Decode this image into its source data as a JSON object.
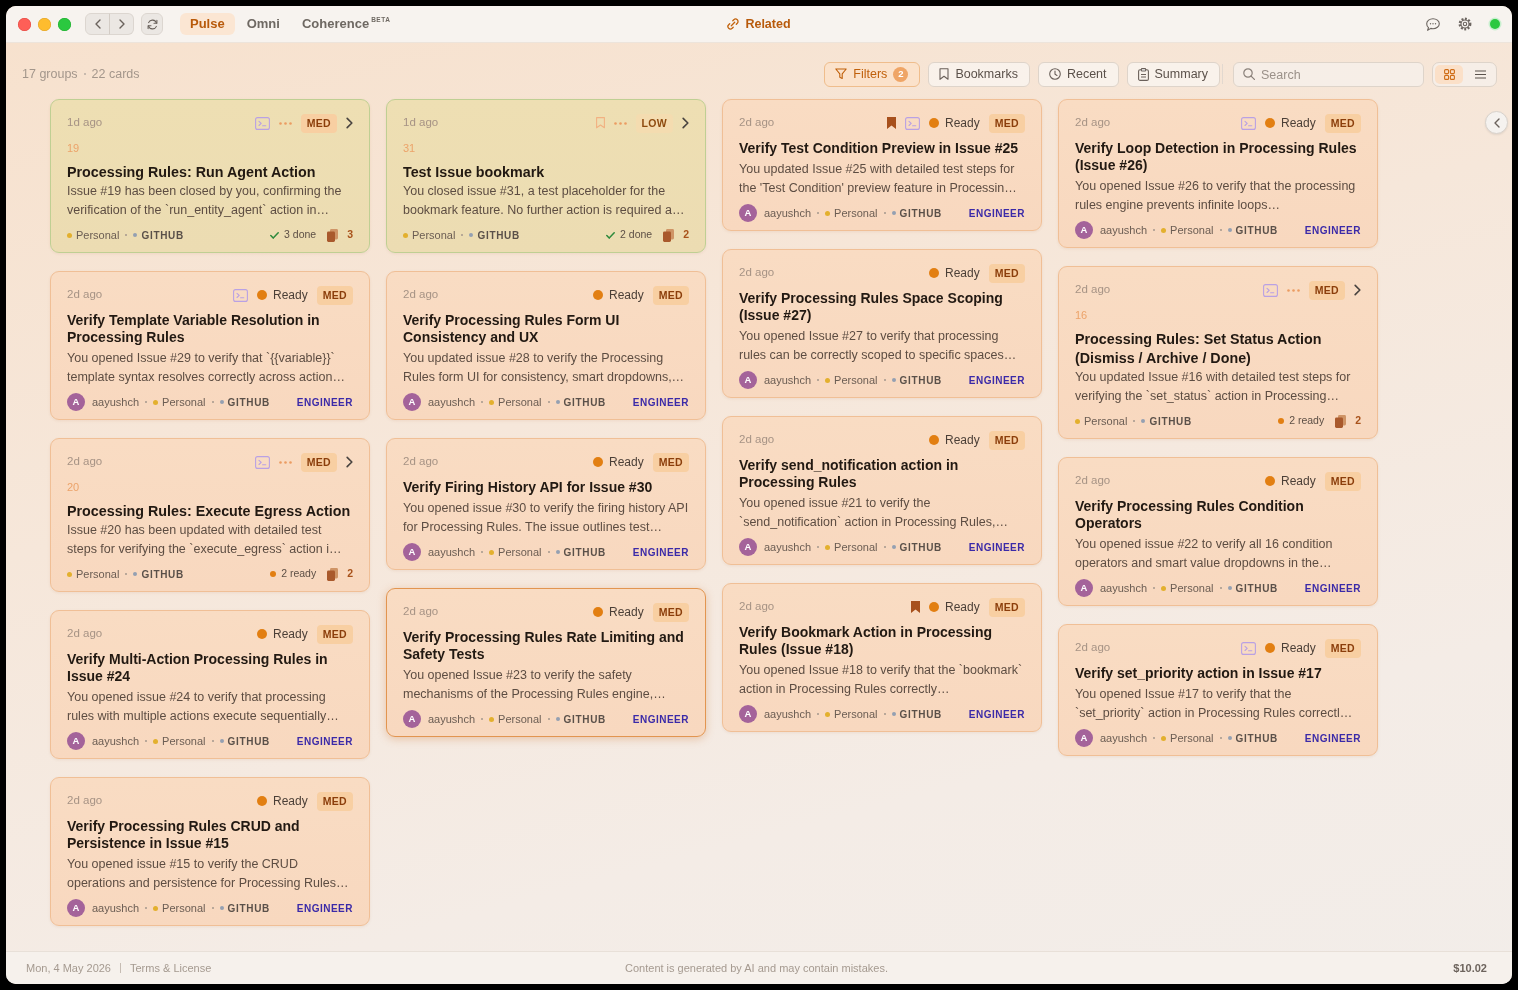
{
  "window": {
    "tabs": [
      {
        "label": "Pulse",
        "selected": true
      },
      {
        "label": "Omni",
        "selected": false
      },
      {
        "label": "Coherence$^{BETA}$",
        "selected": false
      }
    ],
    "header_link": "Related",
    "online": true
  },
  "toolbar": {
    "groups": "17 groups",
    "cards": "22 cards",
    "buttons": [
      {
        "label": "Filters",
        "badge": "2",
        "selected": true
      },
      {
        "label": "Bookmarks",
        "selected": false
      },
      {
        "label": "Recent",
        "selected": false
      },
      {
        "label": "Summary",
        "selected": false
      }
    ],
    "search": {
      "placeholder": "Search"
    },
    "views": [
      {
        "kind": "grid",
        "selected": true
      },
      {
        "kind": "list",
        "selected": false
      }
    ]
  },
  "board": {
    "columns": [
      {
        "cards": [
          {
            "kind": "group",
            "time": "1d ago",
            "terminal": true,
            "priority": {
              "label": "MED",
              "kind": "med"
            },
            "number": "19",
            "title": "Processing Rules: Run Agent Action",
            "description": "Issue #19 has been closed by you, confirming the verification of the `run_entity_agent` action in…",
            "space": "Personal",
            "source": "GITHUB",
            "progress": {
              "kind": "done",
              "text": "3 done"
            },
            "count": "3",
            "selected": false
          },
          {
            "kind": "issue",
            "time": "2d ago",
            "terminal": true,
            "status": "Ready",
            "priority": {
              "label": "MED",
              "kind": "med"
            },
            "title": "Verify Template Variable Resolution in Processing Rules",
            "description": "You opened Issue #29 to verify that `{{variable}}` template syntax resolves correctly across action…",
            "author": {
              "initial": "A",
              "name": "aayushch"
            },
            "space": "Personal",
            "source": "GITHUB",
            "role": "ENGINEER",
            "selected": false
          },
          {
            "kind": "group",
            "time": "2d ago",
            "terminal": true,
            "priority": {
              "label": "MED",
              "kind": "med"
            },
            "number": "20",
            "title": "Processing Rules: Execute Egress Action",
            "description": "Issue #20 has been updated with detailed test steps for verifying the `execute_egress` action i…",
            "space": "Personal",
            "source": "GITHUB",
            "progress": {
              "kind": "ready",
              "text": "2 ready"
            },
            "count": "2",
            "selected": false
          },
          {
            "kind": "issue",
            "time": "2d ago",
            "terminal": false,
            "status": "Ready",
            "priority": {
              "label": "MED",
              "kind": "med"
            },
            "title": "Verify Multi-Action Processing Rules in Issue #24",
            "description": "You opened issue #24 to verify that processing rules with multiple actions execute sequentially…",
            "author": {
              "initial": "A",
              "name": "aayushch"
            },
            "space": "Personal",
            "source": "GITHUB",
            "role": "ENGINEER",
            "selected": false
          },
          {
            "kind": "issue",
            "time": "2d ago",
            "terminal": false,
            "status": "Ready",
            "priority": {
              "label": "MED",
              "kind": "med"
            },
            "title": "Verify Processing Rules CRUD and Persistence in Issue #15",
            "description": "You opened issue #15 to verify the CRUD operations and persistence for Processing Rules…",
            "author": {
              "initial": "A",
              "name": "aayushch"
            },
            "space": "Personal",
            "source": "GITHUB",
            "role": "ENGINEER",
            "selected": false
          }
        ]
      },
      {
        "cards": [
          {
            "kind": "group",
            "time": "1d ago",
            "bookmarked": false,
            "terminal": false,
            "priority": {
              "label": "LOW",
              "kind": "low"
            },
            "number": "31",
            "title": "Test Issue bookmark",
            "description": "You closed issue #31, a test placeholder for the bookmark feature. No further action is required a…",
            "space": "Personal",
            "source": "GITHUB",
            "progress": {
              "kind": "done",
              "text": "2 done"
            },
            "count": "2",
            "selected": false
          },
          {
            "kind": "issue",
            "time": "2d ago",
            "terminal": false,
            "status": "Ready",
            "priority": {
              "label": "MED",
              "kind": "med"
            },
            "title": "Verify Processing Rules Form UI Consistency and UX",
            "description": "You updated issue #28 to verify the Processing Rules form UI for consistency, smart dropdowns,…",
            "author": {
              "initial": "A",
              "name": "aayushch"
            },
            "space": "Personal",
            "source": "GITHUB",
            "role": "ENGINEER",
            "selected": false
          },
          {
            "kind": "issue",
            "time": "2d ago",
            "terminal": false,
            "status": "Ready",
            "priority": {
              "label": "MED",
              "kind": "med"
            },
            "title": "Verify Firing History API for Issue #30",
            "description": "You opened issue #30 to verify the firing history API for Processing Rules. The issue outlines test…",
            "author": {
              "initial": "A",
              "name": "aayushch"
            },
            "space": "Personal",
            "source": "GITHUB",
            "role": "ENGINEER",
            "selected": false
          },
          {
            "kind": "issue",
            "time": "2d ago",
            "terminal": false,
            "status": "Ready",
            "priority": {
              "label": "MED",
              "kind": "med"
            },
            "title": "Verify Processing Rules Rate Limiting and Safety Tests",
            "description": "You opened Issue #23 to verify the safety mechanisms of the Processing Rules engine,…",
            "author": {
              "initial": "A",
              "name": "aayushch"
            },
            "space": "Personal",
            "source": "GITHUB",
            "role": "ENGINEER",
            "selected": true
          }
        ]
      },
      {
        "cards": [
          {
            "kind": "issue",
            "time": "2d ago",
            "bookmarked": true,
            "terminal": true,
            "status": "Ready",
            "priority": {
              "label": "MED",
              "kind": "med"
            },
            "title": "Verify Test Condition Preview in Issue #25",
            "description": "You updated Issue #25 with detailed test steps for the 'Test Condition' preview feature in Processin…",
            "author": {
              "initial": "A",
              "name": "aayushch"
            },
            "space": "Personal",
            "source": "GITHUB",
            "role": "ENGINEER",
            "selected": false
          },
          {
            "kind": "issue",
            "time": "2d ago",
            "terminal": false,
            "status": "Ready",
            "priority": {
              "label": "MED",
              "kind": "med"
            },
            "title": "Verify Processing Rules Space Scoping (Issue #27)",
            "description": "You opened Issue #27 to verify that processing rules can be correctly scoped to specific spaces…",
            "author": {
              "initial": "A",
              "name": "aayushch"
            },
            "space": "Personal",
            "source": "GITHUB",
            "role": "ENGINEER",
            "selected": false
          },
          {
            "kind": "issue",
            "time": "2d ago",
            "terminal": false,
            "status": "Ready",
            "priority": {
              "label": "MED",
              "kind": "med"
            },
            "title": "Verify send_notification action in Processing Rules",
            "description": "You opened issue #21 to verify the `send_notification` action in Processing Rules,…",
            "author": {
              "initial": "A",
              "name": "aayushch"
            },
            "space": "Personal",
            "source": "GITHUB",
            "role": "ENGINEER",
            "selected": false
          },
          {
            "kind": "issue",
            "time": "2d ago",
            "bookmarked": true,
            "terminal": false,
            "status": "Ready",
            "priority": {
              "label": "MED",
              "kind": "med"
            },
            "title": "Verify Bookmark Action in Processing Rules (Issue #18)",
            "description": "You opened Issue #18 to verify that the `bookmark` action in Processing Rules correctly…",
            "author": {
              "initial": "A",
              "name": "aayushch"
            },
            "space": "Personal",
            "source": "GITHUB",
            "role": "ENGINEER",
            "selected": false
          }
        ]
      },
      {
        "cards": [
          {
            "kind": "issue",
            "time": "2d ago",
            "terminal": true,
            "status": "Ready",
            "priority": {
              "label": "MED",
              "kind": "med"
            },
            "title": "Verify Loop Detection in Processing Rules (Issue #26)",
            "description": "You opened Issue #26 to verify that the processing rules engine prevents infinite loops…",
            "author": {
              "initial": "A",
              "name": "aayushch"
            },
            "space": "Personal",
            "source": "GITHUB",
            "role": "ENGINEER",
            "selected": false
          },
          {
            "kind": "group",
            "time": "2d ago",
            "terminal": true,
            "priority": {
              "label": "MED",
              "kind": "med"
            },
            "number": "16",
            "title": "Processing Rules: Set Status Action (Dismiss / Archive / Done)",
            "description": "You updated Issue #16 with detailed test steps for verifying the `set_status` action in Processing…",
            "space": "Personal",
            "source": "GITHUB",
            "progress": {
              "kind": "ready",
              "text": "2 ready"
            },
            "count": "2",
            "selected": false
          },
          {
            "kind": "issue",
            "time": "2d ago",
            "terminal": false,
            "status": "Ready",
            "priority": {
              "label": "MED",
              "kind": "med"
            },
            "title": "Verify Processing Rules Condition Operators",
            "description": "You opened issue #22 to verify all 16 condition operators and smart value dropdowns in the…",
            "author": {
              "initial": "A",
              "name": "aayushch"
            },
            "space": "Personal",
            "source": "GITHUB",
            "role": "ENGINEER",
            "selected": false
          },
          {
            "kind": "issue",
            "time": "2d ago",
            "terminal": true,
            "status": "Ready",
            "priority": {
              "label": "MED",
              "kind": "med"
            },
            "title": "Verify set_priority action in Issue #17",
            "description": "You opened Issue #17 to verify that the `set_priority` action in Processing Rules correctl…",
            "author": {
              "initial": "A",
              "name": "aayushch"
            },
            "space": "Personal",
            "source": "GITHUB",
            "role": "ENGINEER",
            "selected": false
          }
        ]
      }
    ]
  },
  "footer": {
    "date": "Mon, 4 May 2026",
    "link": "Terms & License",
    "notice": "Content is generated by AI and may contain mistakes.",
    "cost": "$10.02"
  }
}
